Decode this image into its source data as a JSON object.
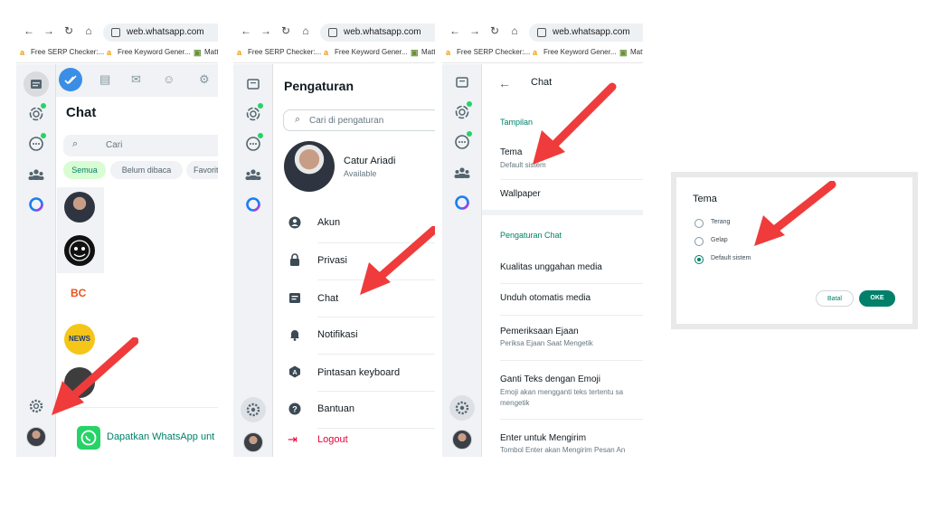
{
  "browser": {
    "url": "web.whatsapp.com",
    "bookmarks": [
      "Free SERP Checker:...",
      "Free Keyword Gener...",
      "Matt"
    ]
  },
  "panel1": {
    "title": "Chat",
    "search_placeholder": "Cari",
    "filters": [
      "Semua",
      "Belum dibaca",
      "Favorit"
    ],
    "chat_logo_text": "NEWS",
    "promo_text": "Dapatkan WhatsApp unt"
  },
  "panel2": {
    "title": "Pengaturan",
    "search_placeholder": "Cari di pengaturan",
    "profile": {
      "name": "Catur Ariadi",
      "status": "Available"
    },
    "menu": [
      "Akun",
      "Privasi",
      "Chat",
      "Notifikasi",
      "Pintasan keyboard",
      "Bantuan",
      "Logout"
    ]
  },
  "panel3": {
    "title": "Chat",
    "section_display": "Tampilan",
    "theme_label": "Tema",
    "theme_value": "Default sistem",
    "wallpaper": "Wallpaper",
    "section_chat": "Pengaturan Chat",
    "media_quality": "Kualitas unggahan media",
    "auto_download": "Unduh otomatis media",
    "spell_title": "Pemeriksaan Ejaan",
    "spell_sub": "Periksa Ejaan Saat Mengetik",
    "emoji_title": "Ganti Teks dengan Emoji",
    "emoji_sub1": "Emoji akan mengganti teks tertentu sa",
    "emoji_sub2": "mengetik",
    "enter_title": "Enter untuk Mengirim",
    "enter_sub": "Tombol Enter akan Mengirim Pesan An"
  },
  "dialog": {
    "title": "Tema",
    "options": [
      "Terang",
      "Gelap",
      "Default sistem"
    ],
    "selected": "Default sistem",
    "cancel": "Batal",
    "ok": "OKE"
  },
  "colors": {
    "accent": "#008069",
    "arrow": "#ef3b3b",
    "logout": "#ea0038",
    "chip_active": "#d9fdd3"
  }
}
